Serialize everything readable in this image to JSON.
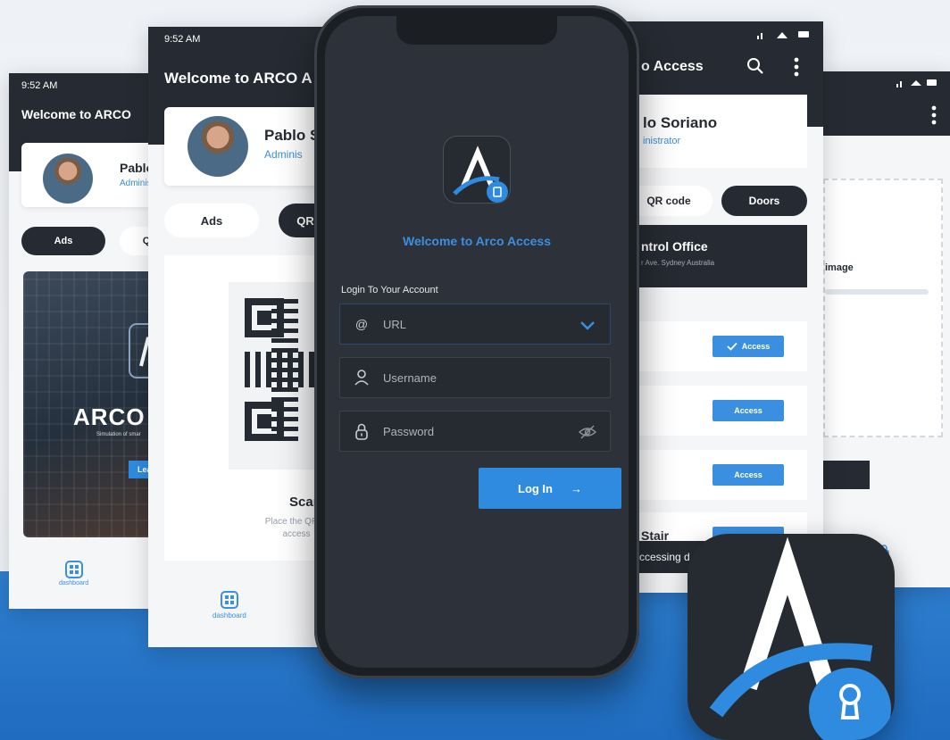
{
  "screen1": {
    "time": "9:52 AM",
    "title": "Welcome to ARCO",
    "profile": {
      "name": "Pablo",
      "role": "Adminis"
    },
    "tabs": {
      "ads": "Ads",
      "other": "Q"
    },
    "banner": {
      "title": "ARCO",
      "subtitle": "Simulation of smar",
      "button": "Learn"
    },
    "nav": {
      "dashboard": "dashboard"
    }
  },
  "screen2": {
    "time": "9:52 AM",
    "title": "Welcome to ARCO A",
    "profile": {
      "name": "Pablo S",
      "role": "Adminis"
    },
    "tabs": {
      "ads": "Ads",
      "qr": "QR"
    },
    "scan": {
      "title": "Scan",
      "description": "Place the QR to access"
    },
    "nav": {
      "dashboard": "dashboard"
    }
  },
  "screen3": {
    "title": "o Access",
    "profile": {
      "name": "lo Soriano",
      "role": "inistrator"
    },
    "tabs": {
      "qr": "QR code",
      "doors": "Doors"
    },
    "office": {
      "name": "ntrol Office",
      "address": "r Ave. Sydney Australia"
    },
    "doors": [
      {
        "name": "",
        "button": "Access",
        "checked": true
      },
      {
        "name": "",
        "button": "Access",
        "checked": false
      },
      {
        "name": "",
        "button": "Access",
        "checked": false
      },
      {
        "name": "Stair",
        "button": "",
        "checked": false
      }
    ],
    "toast": "ccessing d"
  },
  "screen4": {
    "upload_label": "image"
  },
  "login": {
    "welcome": "Welcome to Arco Access",
    "heading": "Login To Your Account",
    "url_placeholder": "URL",
    "username_placeholder": "Username",
    "password_placeholder": "Password",
    "login_button": "Log In",
    "login_arrow": "→"
  },
  "colors": {
    "accent": "#3b8fe0",
    "dark": "#262b33",
    "phone_screen": "#2d3139",
    "band": "#2f7fd0"
  },
  "icons": [
    "search-icon",
    "kebab-menu-icon",
    "at-icon",
    "chevron-down-icon",
    "user-icon",
    "lock-icon",
    "eye-off-icon",
    "arrow-right-icon",
    "dashboard-icon",
    "check-icon",
    "keyhole-icon",
    "wifi-icon",
    "battery-icon",
    "signal-icon"
  ]
}
